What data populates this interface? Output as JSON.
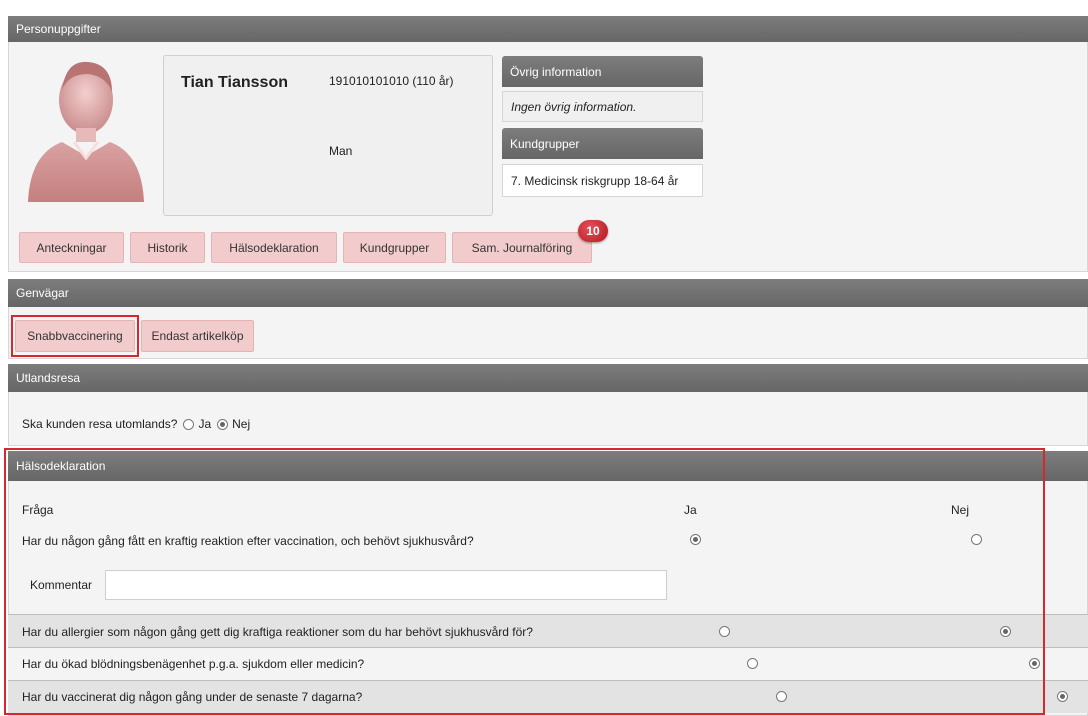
{
  "person_section": {
    "title": "Personuppgifter",
    "name": "Tian Tiansson",
    "id_number": "191010101010 (110 år)",
    "gender": "Man",
    "other_info_title": "Övrig information",
    "other_info_text": "Ingen övrig information.",
    "customer_groups_title": "Kundgrupper",
    "customer_group_value": "7. Medicinsk riskgrupp 18-64 år",
    "tabs": [
      "Anteckningar",
      "Historik",
      "Hälsodeklaration",
      "Kundgrupper",
      "Sam. Journalföring"
    ],
    "journal_badge": "10"
  },
  "shortcuts": {
    "title": "Genvägar",
    "buttons": [
      "Snabbvaccinering",
      "Endast artikelköp"
    ]
  },
  "travel": {
    "title": "Utlandsresa",
    "question": "Ska kunden resa utomlands?",
    "yes_label": "Ja",
    "no_label": "Nej",
    "selected": "Nej"
  },
  "health": {
    "title": "Hälsodeklaration",
    "col_question": "Fråga",
    "col_yes": "Ja",
    "col_no": "Nej",
    "comment_label": "Kommentar",
    "comment_value": "",
    "questions": [
      {
        "text": "Har du någon gång fått en kraftig reaktion efter vaccination, och behövt sjukhusvård?",
        "answer": "Ja"
      },
      {
        "text": "Har du allergier som någon gång gett dig kraftiga reaktioner som du har behövt sjukhusvård för?",
        "answer": "Nej"
      },
      {
        "text": "Har du ökad blödningsbenägenhet p.g.a. sjukdom eller medicin?",
        "answer": "Nej"
      },
      {
        "text": "Har du vaccinerat dig någon gång under de senaste 7 dagarna?",
        "answer": "Nej"
      }
    ]
  },
  "colors": {
    "header_bar": "#707070",
    "pink_button": "#f2cccc",
    "highlight_red": "#d8262f",
    "badge_red": "#c8202a"
  }
}
